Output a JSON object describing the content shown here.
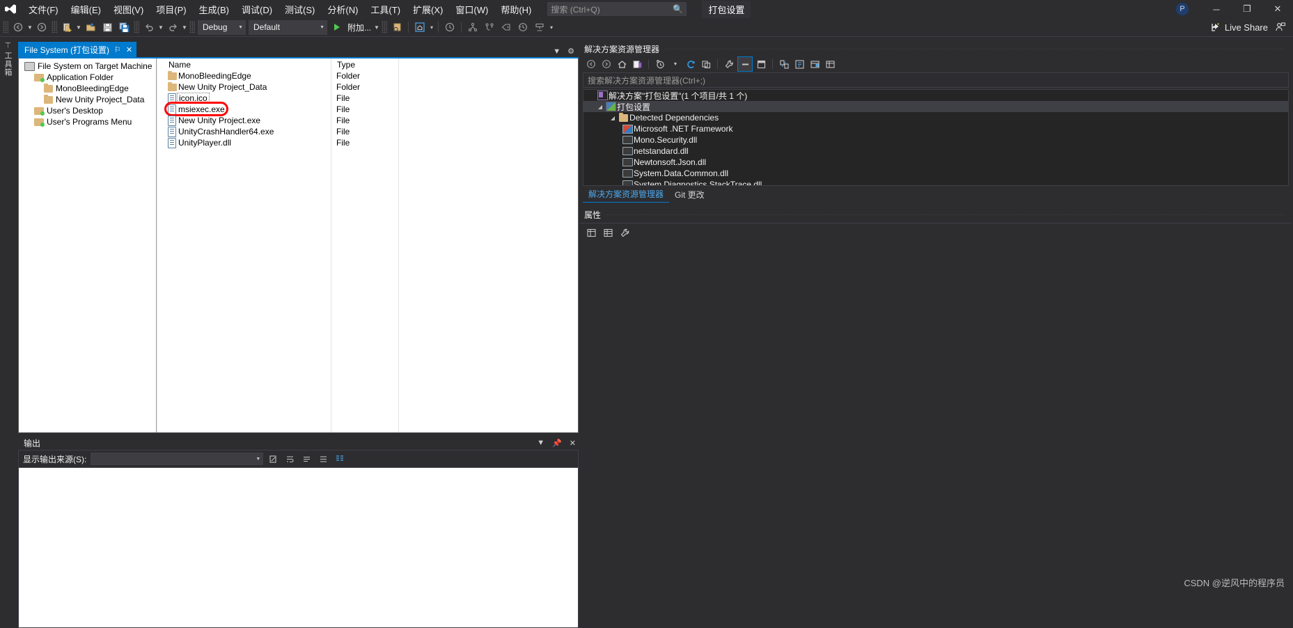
{
  "titlebar": {
    "logo": "vs-logo-icon",
    "menus": [
      {
        "label": "文件(F)"
      },
      {
        "label": "编辑(E)"
      },
      {
        "label": "视图(V)"
      },
      {
        "label": "项目(P)"
      },
      {
        "label": "生成(B)"
      },
      {
        "label": "调试(D)"
      },
      {
        "label": "测试(S)"
      },
      {
        "label": "分析(N)"
      },
      {
        "label": "工具(T)"
      },
      {
        "label": "扩展(X)"
      },
      {
        "label": "窗口(W)"
      },
      {
        "label": "帮助(H)"
      }
    ],
    "search_placeholder": "搜索 (Ctrl+Q)",
    "search_icon": "search-icon",
    "solution_name": "打包设置",
    "account_initial": "P",
    "minimize": "─",
    "restore": "❐",
    "close": "✕"
  },
  "toolbar": {
    "nav_back": "back-icon",
    "nav_forward": "forward-icon",
    "new_project": "new-project-icon",
    "open_file": "open-file-icon",
    "save": "save-icon",
    "save_all": "save-all-icon",
    "undo": "undo-icon",
    "redo": "redo-icon",
    "config_value": "Debug",
    "platform_value": "Default",
    "run_label": "附加...",
    "live_share_label": "Live Share",
    "live_share_icon": "live-share-icon",
    "feedback_icon": "feedback-icon"
  },
  "vdock": {
    "label": "工具箱"
  },
  "designer": {
    "tab_label": "File System (打包设置)",
    "tab_pin": "⚐",
    "tab_close": "✕",
    "tree": [
      {
        "label": "File System on Target Machine",
        "icon": "machine-icon",
        "indent": 0
      },
      {
        "label": "Application Folder",
        "icon": "folder-open-icon",
        "indent": 1
      },
      {
        "label": "MonoBleedingEdge",
        "icon": "folder-icon",
        "indent": 2
      },
      {
        "label": "New Unity Project_Data",
        "icon": "folder-icon",
        "indent": 2
      },
      {
        "label": "User's Desktop",
        "icon": "folder-open-icon",
        "indent": 1
      },
      {
        "label": "User's Programs Menu",
        "icon": "folder-open-icon",
        "indent": 1
      }
    ],
    "columns": [
      "Name",
      "Type"
    ],
    "rows": [
      {
        "name": "MonoBleedingEdge",
        "type": "Folder",
        "icon": "folder-icon",
        "boxed": false,
        "highlight": false
      },
      {
        "name": "New Unity Project_Data",
        "type": "Folder",
        "icon": "folder-icon",
        "boxed": false,
        "highlight": false
      },
      {
        "name": "icon.ico",
        "type": "File",
        "icon": "file-icon",
        "boxed": true,
        "highlight": false
      },
      {
        "name": "msiexec.exe",
        "type": "File",
        "icon": "file-icon",
        "boxed": false,
        "highlight": true
      },
      {
        "name": "New Unity Project.exe",
        "type": "File",
        "icon": "file-icon",
        "boxed": false,
        "highlight": false
      },
      {
        "name": "UnityCrashHandler64.exe",
        "type": "File",
        "icon": "file-icon",
        "boxed": false,
        "highlight": false
      },
      {
        "name": "UnityPlayer.dll",
        "type": "File",
        "icon": "file-icon",
        "boxed": false,
        "highlight": false
      }
    ],
    "highlight_color": "#ff0000"
  },
  "output": {
    "title": "输出",
    "dropdown_icon": "chevron-down-icon",
    "pin_icon": "pin-icon",
    "close_icon": "close-icon",
    "source_label": "显示输出来源(S):",
    "source_value": "",
    "tb_icons": [
      "clear-all-icon",
      "toggle-wordwrap-icon",
      "toggle-gutter-icon",
      "list-icon",
      "find-message-icon"
    ]
  },
  "solution_explorer": {
    "title": "解决方案资源管理器",
    "toolbar_icons": [
      "back-icon",
      "forward-icon",
      "home-icon",
      "switch-views-icon",
      "pending-changes-icon",
      "refresh-icon",
      "collapse-all-icon",
      "properties-icon",
      "show-all-files-icon",
      "preview-selected-icon",
      "sync-with-active-doc-icon",
      "new-folder-icon",
      "filter-icon"
    ],
    "search_placeholder": "搜索解决方案资源管理器(Ctrl+;)",
    "tree": [
      {
        "label": "解决方案\"打包设置\"(1 个项目/共 1 个)",
        "icon": "solution-icon",
        "indent": 0,
        "expander": "",
        "selected": false
      },
      {
        "label": "打包设置",
        "icon": "project-icon",
        "indent": 1,
        "expander": "◢",
        "selected": true
      },
      {
        "label": "Detected Dependencies",
        "icon": "folder-icon",
        "indent": 2,
        "expander": "◢",
        "selected": false
      },
      {
        "label": "Microsoft .NET Framework",
        "icon": "framework-icon",
        "indent": 3,
        "expander": "",
        "selected": false
      },
      {
        "label": "Mono.Security.dll",
        "icon": "reference-icon",
        "indent": 3,
        "expander": "",
        "selected": false
      },
      {
        "label": "netstandard.dll",
        "icon": "reference-icon",
        "indent": 3,
        "expander": "",
        "selected": false
      },
      {
        "label": "Newtonsoft.Json.dll",
        "icon": "reference-icon",
        "indent": 3,
        "expander": "",
        "selected": false
      },
      {
        "label": "System.Data.Common.dll",
        "icon": "reference-icon",
        "indent": 3,
        "expander": "",
        "selected": false
      },
      {
        "label": "System.Diagnostics.StackTrace.dll",
        "icon": "reference-icon",
        "indent": 3,
        "expander": "",
        "selected": false
      }
    ],
    "tabs": [
      {
        "label": "解决方案资源管理器",
        "active": true
      },
      {
        "label": "Git 更改",
        "active": false
      }
    ]
  },
  "properties": {
    "title": "属性",
    "toolbar_icons": [
      "categorized-icon",
      "alphabetical-icon",
      "properties-page-icon"
    ]
  },
  "watermark": {
    "text": "CSDN @逆风中的程序员"
  },
  "colors": {
    "accent": "#007acc",
    "chrome": "#2d2d30",
    "panel": "#252526",
    "highlight_red": "#ff0000",
    "folder": "#dcb67a"
  }
}
